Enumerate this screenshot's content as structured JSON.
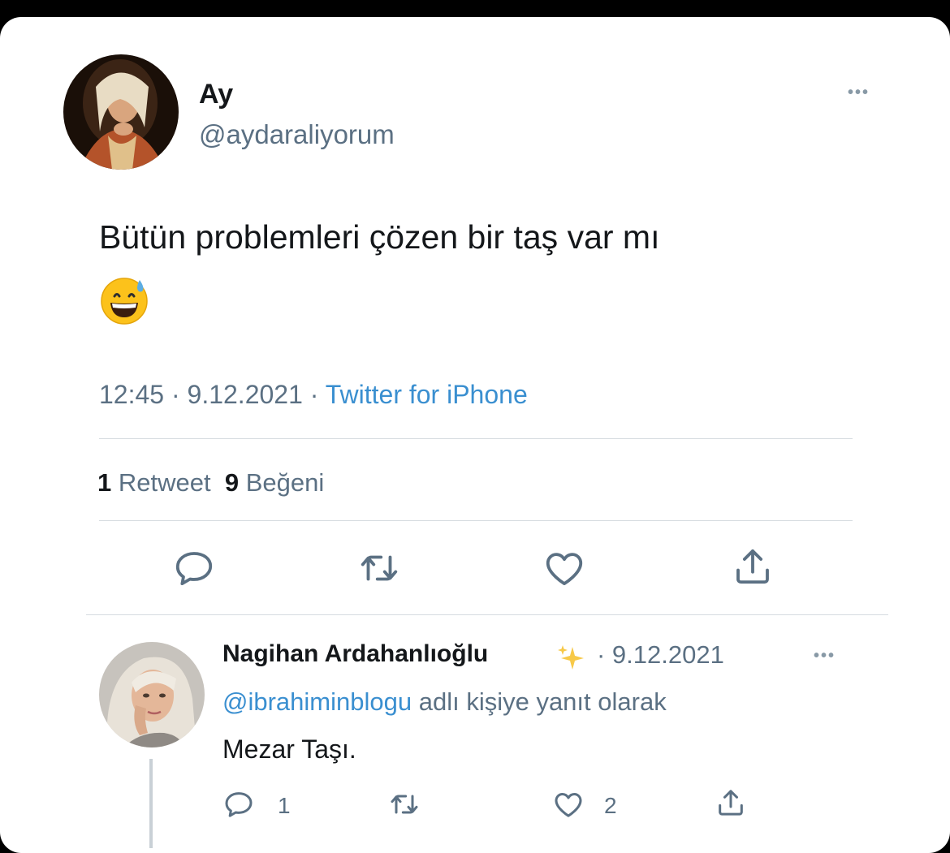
{
  "tweet": {
    "name": "Ay",
    "handle": "@aydaraliyorum",
    "text": "Bütün problemleri çözen bir taş var mı",
    "emoji": "grinning-face-with-sweat-emoji",
    "time": "12:45",
    "separator": " · ",
    "date": "9.12.2021",
    "source": "Twitter for iPhone",
    "retweet_count": "1",
    "retweet_label": "Retweet",
    "like_count": "9",
    "like_label": "Beğeni",
    "more_label": "•••"
  },
  "reply": {
    "name": "Nagihan Ardahanlıoğlu",
    "date_prefix": "· 9.12.2021",
    "mention": "@ibrahiminblogu",
    "reply_suffix": "adlı kişiye yanıt olarak",
    "text": "Mezar Taşı.",
    "reply_count": "1",
    "like_count": "2",
    "more_label": "•••"
  },
  "colors": {
    "text_primary": "#14171a",
    "text_secondary": "#5b7083",
    "link": "#3a8fd0",
    "icon": "#5b7083",
    "divider": "#d6dbe0"
  },
  "icons": [
    "reply-icon",
    "retweet-icon",
    "like-icon",
    "share-icon",
    "sparkle-icon",
    "more-icon"
  ]
}
